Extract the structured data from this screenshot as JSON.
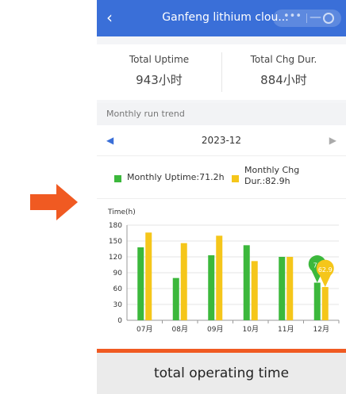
{
  "header": {
    "back_icon": "chevron-left-icon",
    "title": "Ganfeng lithium clou...",
    "more_icon": "more-dots-icon",
    "minimize_icon": "minus-icon",
    "close_icon": "circle-close-icon",
    "color": "#3a6fd8"
  },
  "stats": [
    {
      "label": "Total Uptime",
      "value": "943小时"
    },
    {
      "label": "Total Chg Dur.",
      "value": "884小时"
    }
  ],
  "section_title": "Monthly run trend",
  "month_nav": {
    "prev_icon": "circle-chevron-left-icon",
    "month": "2023-12",
    "next_icon": "circle-chevron-right-icon"
  },
  "legend": [
    {
      "label": "Monthly Uptime:71.2h",
      "color": "#3cb83c"
    },
    {
      "label": "Monthly Chg Dur.:82.9h",
      "color": "#f5c61a"
    }
  ],
  "chart_data": {
    "type": "bar",
    "ylabel": "Time(h)",
    "ylim": [
      0,
      180
    ],
    "yticks": [
      0,
      30,
      60,
      90,
      120,
      150,
      180
    ],
    "categories": [
      "07月",
      "08月",
      "09月",
      "10月",
      "11月",
      "12月"
    ],
    "series": [
      {
        "name": "Monthly Uptime",
        "color": "#3cb83c",
        "values": [
          138,
          80,
          123,
          142,
          120,
          71.2
        ]
      },
      {
        "name": "Monthly Chg Dur.",
        "color": "#f5c61a",
        "values": [
          166,
          146,
          160,
          112,
          120,
          62.9
        ]
      }
    ],
    "annotations": [
      "71",
      "62.9"
    ]
  },
  "caption": "total operating time",
  "accent_color": "#f05a22"
}
